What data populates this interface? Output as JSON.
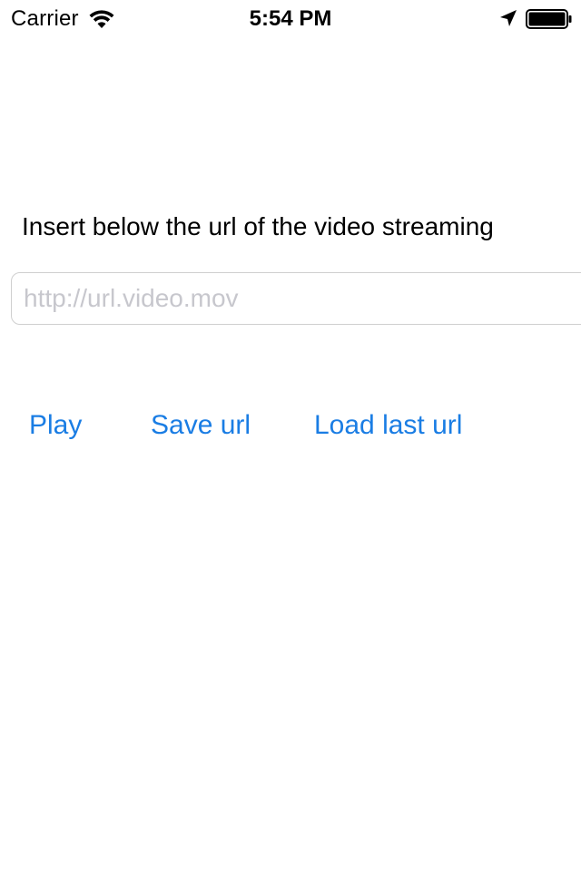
{
  "status_bar": {
    "carrier": "Carrier",
    "time": "5:54 PM",
    "icons": [
      "wifi-icon",
      "location-arrow-icon",
      "battery-icon"
    ],
    "battery_level": 1.0
  },
  "main": {
    "instruction": "Insert below the url of the video streaming",
    "url_input": {
      "value": "",
      "placeholder": "http://url.video.mov"
    },
    "buttons": {
      "play": "Play",
      "save": "Save url",
      "load": "Load last url"
    }
  },
  "colors": {
    "accent": "#1a7de4",
    "placeholder": "#c7c7cd",
    "field_border": "#cfcfcf",
    "background": "#ffffff"
  }
}
